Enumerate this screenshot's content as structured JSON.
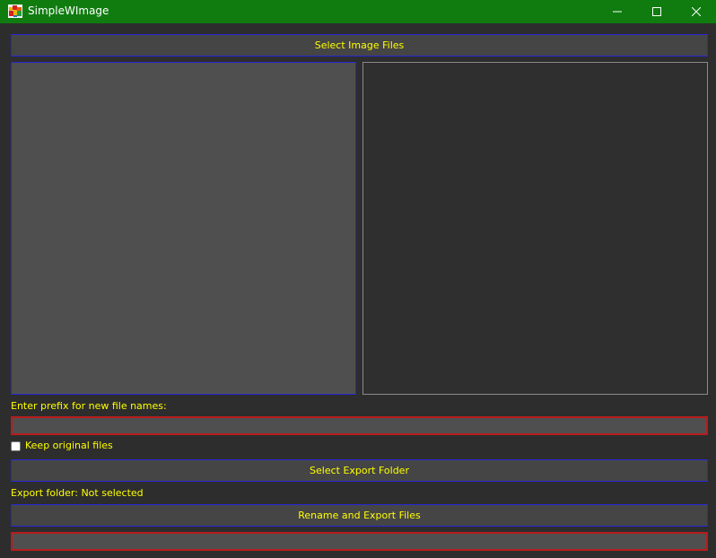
{
  "window": {
    "title": "SimpleWImage",
    "icon": "app-logo-icon",
    "colors": {
      "titlebar": "#107c10",
      "background": "#2d2d2d",
      "text": "#ffff00",
      "button_border": "#2626d9",
      "input_border": "#b81c1c"
    },
    "controls": {
      "minimize_icon": "minimize-icon",
      "maximize_icon": "maximize-icon",
      "close_icon": "close-icon"
    }
  },
  "main": {
    "select_images_label": "Select Image Files",
    "prefix_label": "Enter prefix for new file names:",
    "prefix_value": "",
    "keep_original_label": "Keep original files",
    "keep_original_checked": false,
    "select_export_label": "Select Export Folder",
    "export_status": "Export folder: Not selected",
    "rename_export_label": "Rename and Export Files",
    "bottom_field_value": ""
  }
}
